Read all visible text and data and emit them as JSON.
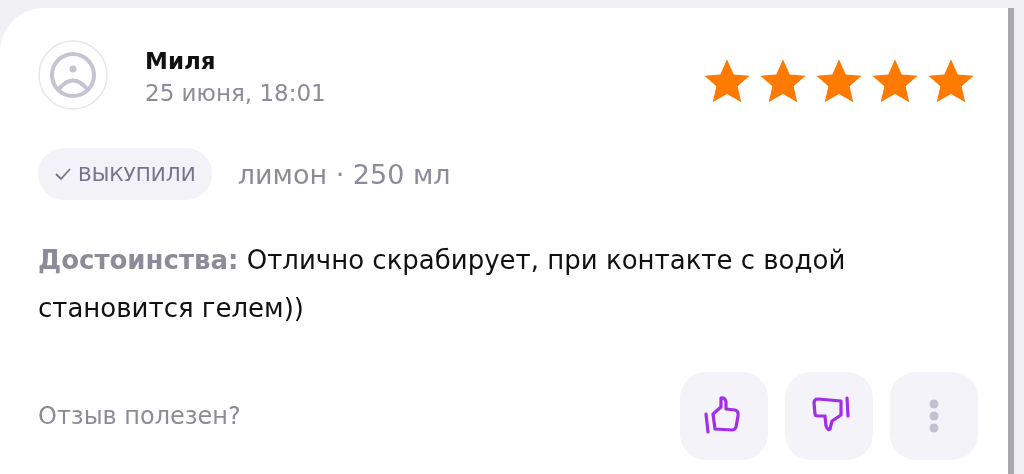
{
  "review": {
    "author": "Миля",
    "date": "25 июня, 18:01",
    "stars": 5,
    "badge": {
      "label": "ВЫКУПИЛИ",
      "checked": true
    },
    "variant": "лимон · 250 мл",
    "pros_label": "Достоинства:",
    "pros_text": "Отлично скрабирует, при контакте с водой становится гелем))",
    "helpful_question": "Отзыв полезен?"
  }
}
